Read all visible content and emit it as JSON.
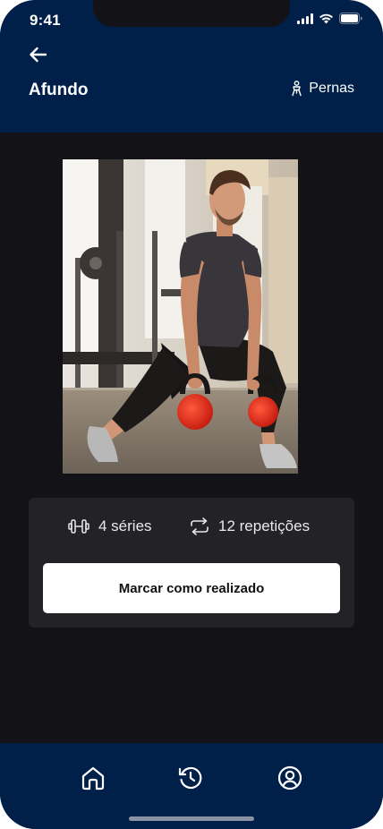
{
  "status_bar": {
    "time": "9:41"
  },
  "header": {
    "title": "Afundo",
    "muscle_group": "Pernas"
  },
  "exercise": {
    "series_label": "4 séries",
    "reps_label": "12 repetições",
    "done_button_label": "Marcar como realizado"
  },
  "colors": {
    "header_bg": "#00204a",
    "page_bg": "#131216",
    "card_bg": "#232226",
    "button_bg": "#ffffff"
  },
  "icons": {
    "back": "arrow-left-icon",
    "muscle": "person-legs-icon",
    "series": "dumbbell-icon",
    "reps": "repeat-icon",
    "nav": [
      "home-icon",
      "history-icon",
      "profile-icon"
    ]
  }
}
